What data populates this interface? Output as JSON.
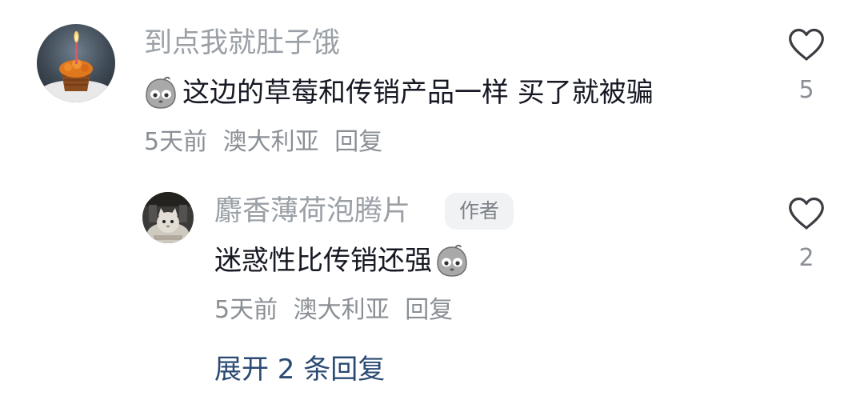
{
  "comments": [
    {
      "username": "到点我就肚子饿",
      "emoji": "pale-face-emoji",
      "text": "这边的草莓和传销产品一样 买了就被骗",
      "time": "5天前",
      "location": "澳大利亚",
      "reply_label": "回复",
      "like_icon": "heart-outline-icon",
      "like_count": "5"
    },
    {
      "username": "麝香薄荷泡腾片",
      "author_badge": "作者",
      "text": "迷惑性比传销还强",
      "emoji": "pale-face-emoji",
      "time": "5天前",
      "location": "澳大利亚",
      "reply_label": "回复",
      "like_icon": "heart-outline-icon",
      "like_count": "2"
    }
  ],
  "expand_replies_label": "展开 2 条回复",
  "colors": {
    "username": "#9aa0a6",
    "content": "#161823",
    "meta": "#8a8f95",
    "link": "#2b4a73",
    "badge_bg": "#f1f2f4"
  }
}
